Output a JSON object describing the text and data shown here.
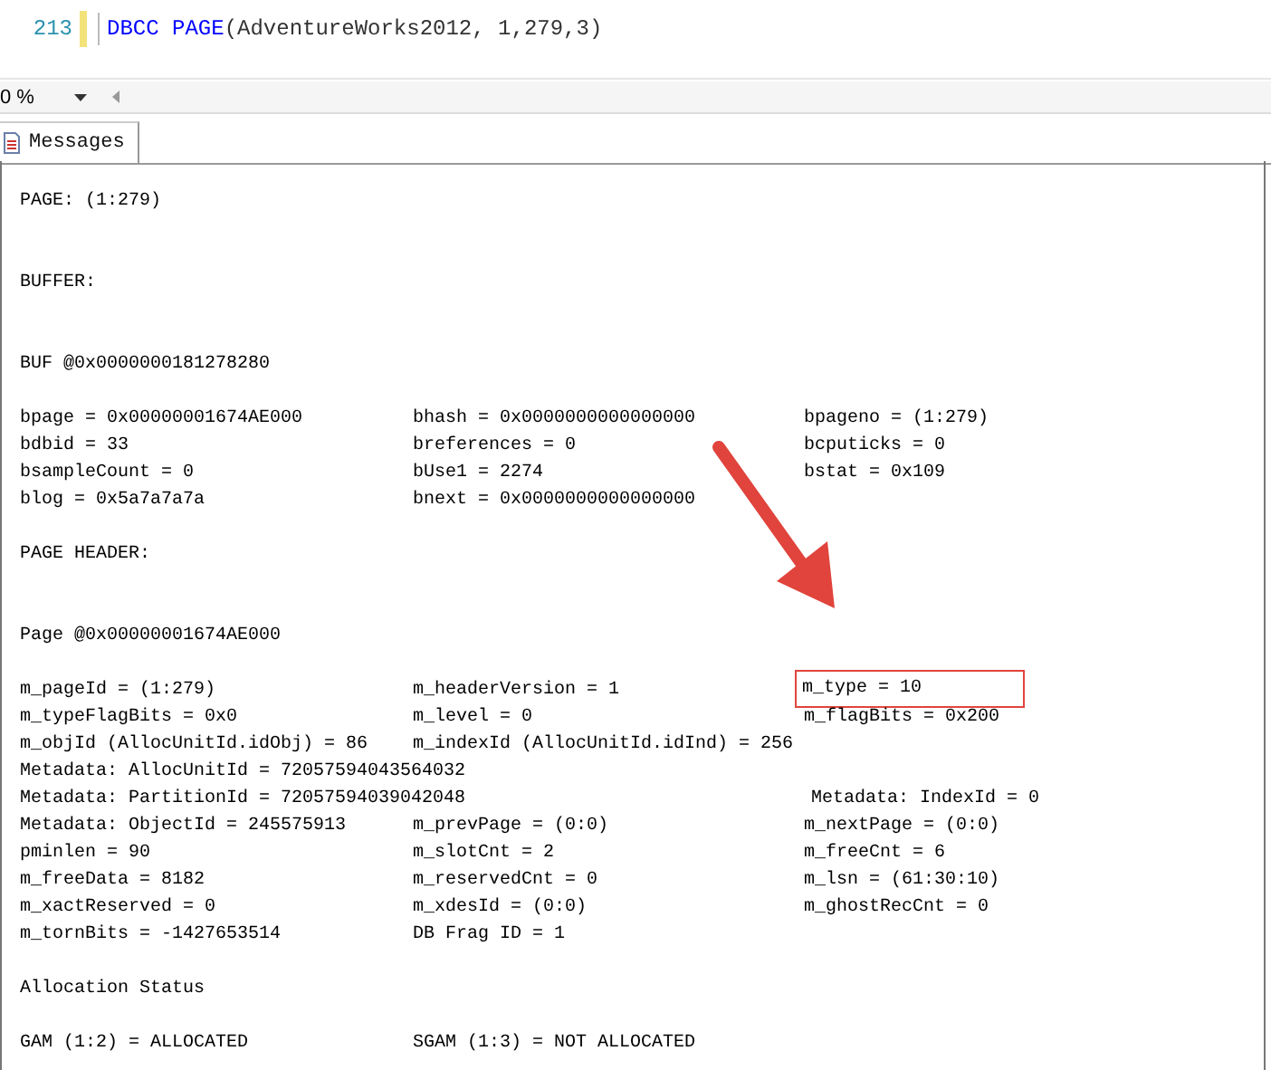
{
  "editor": {
    "line_number": "213",
    "modified": true,
    "tokens": [
      {
        "kind": "keyword",
        "text": "DBCC PAGE"
      },
      {
        "kind": "plain",
        "text": "(AdventureWorks2012, 1,279,3)"
      }
    ]
  },
  "zoom": {
    "value": "0 %"
  },
  "tabs": [
    {
      "label": "Messages",
      "selected": true
    }
  ],
  "messages": [
    {
      "kind": "text",
      "text": "PAGE: (1:279)"
    },
    {
      "kind": "blank"
    },
    {
      "kind": "blank"
    },
    {
      "kind": "text",
      "text": "BUFFER:"
    },
    {
      "kind": "blank"
    },
    {
      "kind": "blank"
    },
    {
      "kind": "text",
      "text": "BUF @0x0000000181278280"
    },
    {
      "kind": "blank"
    },
    {
      "kind": "fields",
      "cells": [
        {
          "text": "bpage = 0x00000001674AE000",
          "highlighted": false
        },
        {
          "text": "bhash = 0x0000000000000000",
          "highlighted": false
        },
        {
          "text": "bpageno = (1:279)",
          "highlighted": false
        }
      ]
    },
    {
      "kind": "fields",
      "cells": [
        {
          "text": "bdbid = 33",
          "highlighted": false
        },
        {
          "text": "breferences = 0",
          "highlighted": false
        },
        {
          "text": "bcputicks = 0",
          "highlighted": false
        }
      ]
    },
    {
      "kind": "fields",
      "cells": [
        {
          "text": "bsampleCount = 0",
          "highlighted": false
        },
        {
          "text": "bUse1 = 2274",
          "highlighted": false
        },
        {
          "text": "bstat = 0x109",
          "highlighted": false
        }
      ]
    },
    {
      "kind": "fields",
      "cells": [
        {
          "text": "blog = 0x5a7a7a7a",
          "highlighted": false
        },
        {
          "text": "bnext = 0x0000000000000000",
          "highlighted": false
        }
      ]
    },
    {
      "kind": "blank"
    },
    {
      "kind": "text",
      "text": "PAGE HEADER:"
    },
    {
      "kind": "blank"
    },
    {
      "kind": "blank"
    },
    {
      "kind": "text",
      "text": "Page @0x00000001674AE000"
    },
    {
      "kind": "blank"
    },
    {
      "kind": "fields",
      "cells": [
        {
          "text": "m_pageId = (1:279)",
          "highlighted": false
        },
        {
          "text": "m_headerVersion = 1",
          "highlighted": false
        },
        {
          "text": "m_type = 10",
          "highlighted": true
        }
      ]
    },
    {
      "kind": "fields",
      "cells": [
        {
          "text": "m_typeFlagBits = 0x0",
          "highlighted": false
        },
        {
          "text": "m_level = 0",
          "highlighted": false
        },
        {
          "text": "m_flagBits = 0x200",
          "highlighted": false
        }
      ]
    },
    {
      "kind": "fields",
      "cells": [
        {
          "text": "m_objId (AllocUnitId.idObj) = 86",
          "highlighted": false
        },
        {
          "text": "m_indexId (AllocUnitId.idInd) = 256",
          "highlighted": false
        }
      ]
    },
    {
      "kind": "text",
      "text": "Metadata: AllocUnitId = 72057594043564032"
    },
    {
      "kind": "fields_wide",
      "cells": [
        {
          "text": "Metadata: PartitionId = 72057594039042048",
          "highlighted": false
        },
        {
          "text": "Metadata: IndexId = 0",
          "highlighted": false
        }
      ]
    },
    {
      "kind": "fields",
      "cells": [
        {
          "text": "Metadata: ObjectId = 245575913",
          "highlighted": false
        },
        {
          "text": "m_prevPage = (0:0)",
          "highlighted": false
        },
        {
          "text": "m_nextPage = (0:0)",
          "highlighted": false
        }
      ]
    },
    {
      "kind": "fields",
      "cells": [
        {
          "text": "pminlen = 90",
          "highlighted": false
        },
        {
          "text": "m_slotCnt = 2",
          "highlighted": false
        },
        {
          "text": "m_freeCnt = 6",
          "highlighted": false
        }
      ]
    },
    {
      "kind": "fields",
      "cells": [
        {
          "text": "m_freeData = 8182",
          "highlighted": false
        },
        {
          "text": "m_reservedCnt = 0",
          "highlighted": false
        },
        {
          "text": "m_lsn = (61:30:10)",
          "highlighted": false
        }
      ]
    },
    {
      "kind": "fields",
      "cells": [
        {
          "text": "m_xactReserved = 0",
          "highlighted": false
        },
        {
          "text": "m_xdesId = (0:0)",
          "highlighted": false
        },
        {
          "text": "m_ghostRecCnt = 0",
          "highlighted": false
        }
      ]
    },
    {
      "kind": "fields",
      "cells": [
        {
          "text": "m_tornBits = -1427653514",
          "highlighted": false
        },
        {
          "text": "DB Frag ID = 1",
          "highlighted": false
        }
      ]
    },
    {
      "kind": "blank"
    },
    {
      "kind": "text",
      "text": "Allocation Status"
    },
    {
      "kind": "blank"
    },
    {
      "kind": "fields",
      "cells": [
        {
          "text": "GAM (1:2) = ALLOCATED",
          "highlighted": false
        },
        {
          "text": "SGAM (1:3) = NOT ALLOCATED",
          "highlighted": false
        }
      ]
    }
  ]
}
